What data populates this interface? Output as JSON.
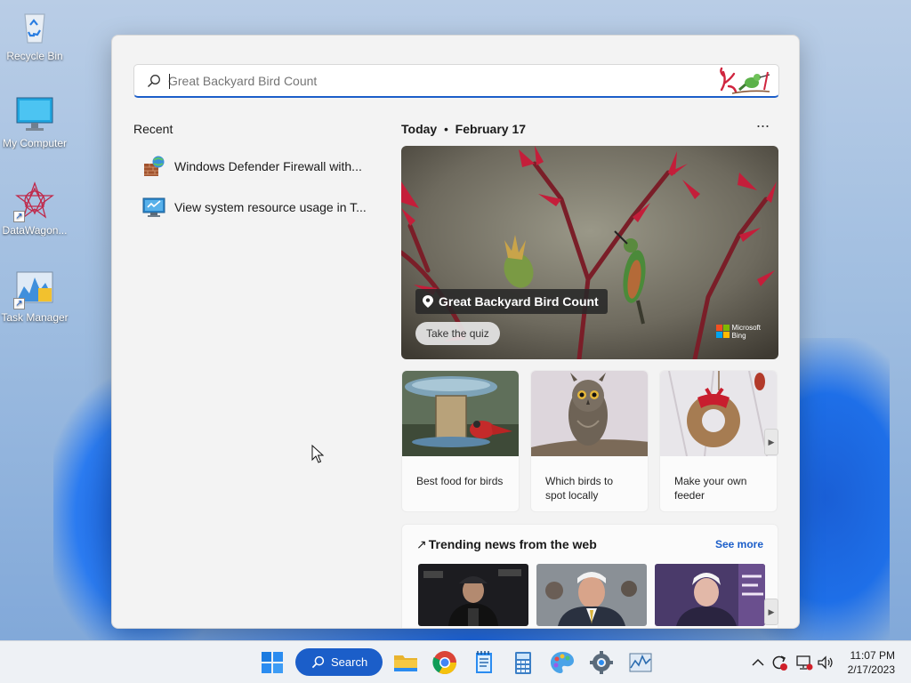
{
  "desktop": {
    "icons": [
      {
        "label": "Recycle Bin",
        "icon": "recycle-bin-icon"
      },
      {
        "label": "My Computer",
        "icon": "monitor-icon"
      },
      {
        "label": "DataWagon...",
        "icon": "datawagon-icon"
      },
      {
        "label": "Task Manager",
        "icon": "task-manager-icon"
      }
    ]
  },
  "search": {
    "value": "",
    "placeholder": "Great Backyard Bird Count"
  },
  "recent": {
    "title": "Recent",
    "items": [
      {
        "label": "Windows Defender Firewall with...",
        "icon": "firewall-icon"
      },
      {
        "label": "View system resource usage in T...",
        "icon": "resource-monitor-icon"
      }
    ]
  },
  "today": {
    "label": "Today",
    "separator": "•",
    "date": "February 17",
    "more": "···"
  },
  "hero": {
    "title": "Great Backyard Bird Count",
    "button": "Take the quiz",
    "brand_line1": "Microsoft",
    "brand_line2": "Bing"
  },
  "cards": [
    {
      "caption": "Best food for birds"
    },
    {
      "caption": "Which birds to spot locally"
    },
    {
      "caption": "Make your own feeder"
    }
  ],
  "trending": {
    "title": "Trending news from the web",
    "see_more": "See more"
  },
  "taskbar": {
    "search_label": "Search",
    "time": "11:07 PM",
    "date": "2/17/2023"
  },
  "colors": {
    "accent": "#1b5ec9"
  }
}
